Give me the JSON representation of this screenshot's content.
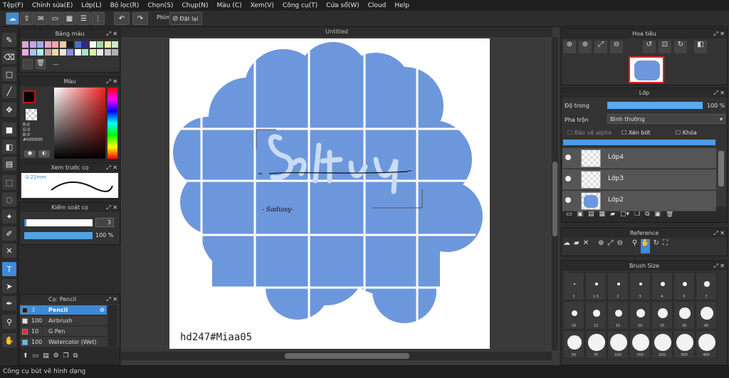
{
  "menu": [
    "Tệp(F)",
    "Chỉnh sửa(E)",
    "Lớp(L)",
    "Bộ lọc(R)",
    "Chọn(S)",
    "Chụp(N)",
    "Màu (C)",
    "Xem(V)",
    "Công cụ(T)",
    "Cửa sổ(W)",
    "Cloud",
    "Help"
  ],
  "toolbar": {
    "phim_label": "Phím",
    "reset_label": "Đặt lại"
  },
  "palette": {
    "title": "Bảng màu",
    "text": "---",
    "colors": [
      "#d9a6d9",
      "#c8a6e6",
      "#a6a6f0",
      "#e6a6c8",
      "#f0a6a6",
      "#f0c8a6",
      "#1a1a1a",
      "#4a6fd8",
      "#2c2c8a",
      "#ffffff",
      "#a6d9a6",
      "#f0f0a6",
      "#cfe6cf",
      "#f0a6e6",
      "#a6c8f0",
      "#a6f0f0",
      "#c8a6a6",
      "#f0d9a6",
      "#e6e6e6",
      "#8a8af0",
      "#ffffff",
      "#a6e6c8",
      "#d9f0a6",
      "#eaeaea",
      "#c8c8c8",
      "#b0b0b0"
    ]
  },
  "color": {
    "title": "Màu",
    "r": "R:0",
    "g": "G:0",
    "b": "B:0",
    "hex": "#000000",
    "primary": "#000000",
    "accent": "#c0151b"
  },
  "brush_preview": {
    "title": "Xem trước cọ",
    "size": "0.22mm"
  },
  "brush_control": {
    "title": "Kiểm soát cọ",
    "size": "3",
    "opacity": "100 %",
    "opacity_level": 1.0
  },
  "brush_list": {
    "title": "Cọ: Pencil",
    "items": [
      {
        "size": "3",
        "name": "Pencil",
        "color": "#1e1e1e",
        "selected": true
      },
      {
        "size": "100",
        "name": "Airbrush",
        "color": "#e0e0e0",
        "selected": false
      },
      {
        "size": "10",
        "name": "G Pen",
        "color": "#e02a2a",
        "selected": false
      },
      {
        "size": "100",
        "name": "Watercolor (Wet)",
        "color": "#4fc3f7",
        "selected": false
      }
    ]
  },
  "document": {
    "tab": "Untitled",
    "watermark": "hd247#Miaa05",
    "sign_small": "- Sadiasy-",
    "fill_color": "#6d97dc"
  },
  "navigator": {
    "title": "Hoa tiêu"
  },
  "layers": {
    "title": "Lớp",
    "opacity_label": "Độ trong",
    "opacity_value": "100 %",
    "blend_label": "Pha trộn",
    "blend_value": "Bình thường",
    "protect_alpha": "Bảo vệ alpha",
    "clip": "Xén bớt",
    "lock": "Khóa",
    "items": [
      {
        "name": "Lớp4"
      },
      {
        "name": "Lớp3"
      },
      {
        "name": "Lớp2"
      }
    ]
  },
  "reference": {
    "title": "Reference"
  },
  "brush_size": {
    "title": "Brush Size",
    "sizes": [
      "1",
      "1.5",
      "2",
      "3",
      "4",
      "5",
      "7",
      "10",
      "12",
      "15",
      "20",
      "25",
      "30",
      "40",
      "50",
      "70",
      "100",
      "150",
      "200",
      "300",
      "400"
    ]
  },
  "status": "Công cụ bút vẽ hình dạng"
}
